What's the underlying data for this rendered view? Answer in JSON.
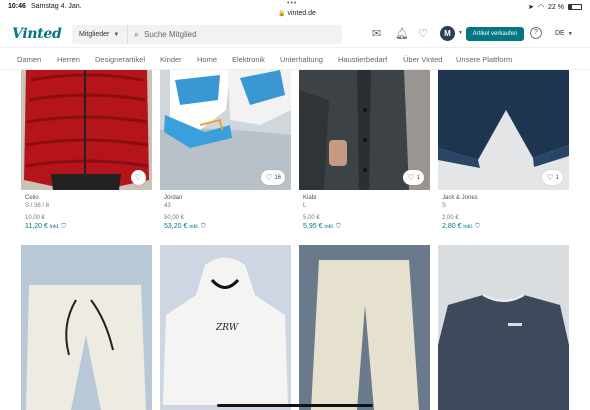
{
  "status_bar": {
    "time": "10:46",
    "date": "Samstag 4. Jan.",
    "url": "vinted.de",
    "battery": "22 %"
  },
  "header": {
    "logo": "Vinted",
    "search_category": "Mitglieder",
    "search_placeholder": "Suche Mitglied",
    "avatar_letter": "M",
    "sell_button": "Artikel verkaufen",
    "language": "DE"
  },
  "nav": [
    "Damen",
    "Herren",
    "Designerartikel",
    "Kinder",
    "Home",
    "Elektronik",
    "Unterhaltung",
    "Haustierbedarf",
    "Über Vinted",
    "Unsere Plattform"
  ],
  "items": [
    {
      "brand": "Celio",
      "size": "S / 36 / 8",
      "price": "10,00 €",
      "total": "11,20 €",
      "incl": "inkl.",
      "favorites": ""
    },
    {
      "brand": "Jordan",
      "size": "43",
      "price": "50,00 €",
      "total": "53,20 €",
      "incl": "inkl.",
      "favorites": "16"
    },
    {
      "brand": "Kiabi",
      "size": "L",
      "price": "5,00 €",
      "total": "5,95 €",
      "incl": "inkl.",
      "favorites": "1"
    },
    {
      "brand": "Jack & Jones",
      "size": "S",
      "price": "2,00 €",
      "total": "2,80 €",
      "incl": "inkl.",
      "favorites": "1"
    }
  ],
  "colors": {
    "brand": "#007782"
  }
}
